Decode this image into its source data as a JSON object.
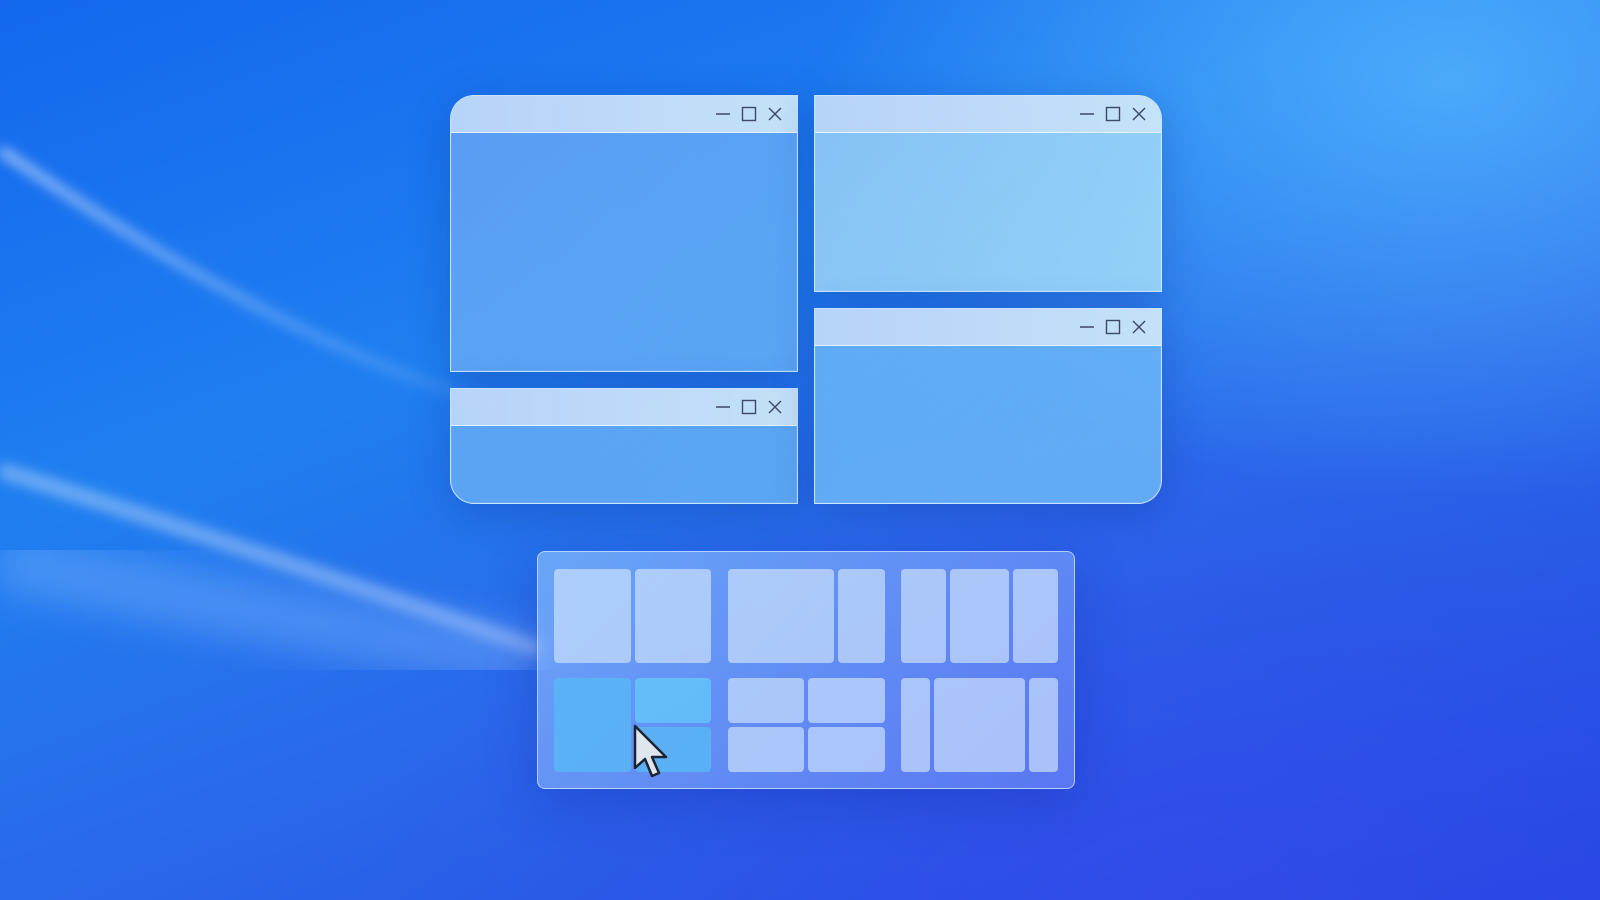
{
  "desktop": {
    "colors": {
      "background_primary": "#1f7ff0",
      "background_deep": "#2147e2",
      "window_glass": "#8cc8f5",
      "zone": "#c8defc",
      "zone_highlight": "#5ab4f5"
    }
  },
  "windows": [
    {
      "id": "w1",
      "icons": [
        "minimize-icon",
        "maximize-icon",
        "close-icon"
      ]
    },
    {
      "id": "w2",
      "icons": [
        "minimize-icon",
        "maximize-icon",
        "close-icon"
      ]
    },
    {
      "id": "w3",
      "icons": [
        "minimize-icon",
        "maximize-icon",
        "close-icon"
      ]
    },
    {
      "id": "w4",
      "icons": [
        "minimize-icon",
        "maximize-icon",
        "close-icon"
      ]
    }
  ],
  "snap_layouts": {
    "layouts": [
      {
        "name": "halves"
      },
      {
        "name": "two-thirds-one-third"
      },
      {
        "name": "three-columns"
      },
      {
        "name": "half-and-quarters",
        "highlighted_zone": "top-right"
      },
      {
        "name": "four-quadrants"
      },
      {
        "name": "wide-center-columns"
      }
    ]
  },
  "cursor": {
    "icon": "arrow-cursor-icon"
  }
}
